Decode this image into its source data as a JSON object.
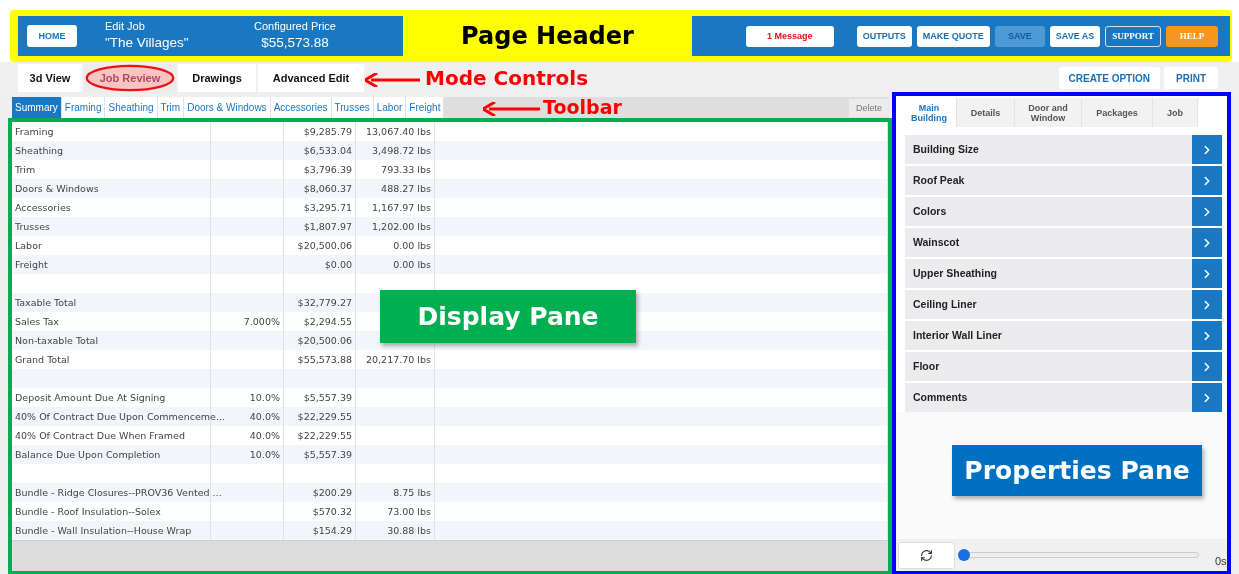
{
  "header": {
    "home_button": "HOME",
    "job_caption": "Edit Job",
    "job_name": "\"The Villages\"",
    "price_caption": "Configured Price",
    "price": "$55,573.88",
    "buttons": [
      {
        "label": "1 Message",
        "kind": "message"
      },
      {
        "label": "OUTPUTS",
        "kind": "normal"
      },
      {
        "label": "MAKE QUOTE",
        "kind": "normal"
      },
      {
        "label": "SAVE",
        "kind": "disabled"
      },
      {
        "label": "SAVE AS",
        "kind": "normal"
      },
      {
        "label": "SUPPORT",
        "kind": "outline"
      },
      {
        "label": "HELP",
        "kind": "orange"
      }
    ]
  },
  "mode_tabs": [
    {
      "label": "3d View",
      "selected": false,
      "circled": false
    },
    {
      "label": "Job Review",
      "selected": true,
      "circled": true
    },
    {
      "label": "Drawings",
      "selected": false,
      "circled": false
    },
    {
      "label": "Advanced Edit",
      "selected": false,
      "circled": false
    }
  ],
  "mode_actions": [
    "CREATE OPTION",
    "PRINT"
  ],
  "toolbar": {
    "tabs": [
      {
        "label": "Summary",
        "selected": true
      },
      {
        "label": "Framing",
        "selected": false
      },
      {
        "label": "Sheathing",
        "selected": false
      },
      {
        "label": "Trim",
        "selected": false
      },
      {
        "label": "Doors & Windows",
        "selected": false
      },
      {
        "label": "Accessories",
        "selected": false
      },
      {
        "label": "Trusses",
        "selected": false
      },
      {
        "label": "Labor",
        "selected": false
      },
      {
        "label": "Freight",
        "selected": false
      }
    ],
    "delete_button": "Delete"
  },
  "summary_table": {
    "rows": [
      {
        "kind": "line",
        "item": "Framing",
        "price": "$9,285.79",
        "weight": "13,067.40 lbs"
      },
      {
        "kind": "line",
        "item": "Sheathing",
        "price": "$6,533.04",
        "weight": "3,498.72 lbs"
      },
      {
        "kind": "line",
        "item": "Trim",
        "price": "$3,796.39",
        "weight": "793.33 lbs"
      },
      {
        "kind": "line",
        "item": "Doors & Windows",
        "price": "$8,060.37",
        "weight": "488.27 lbs"
      },
      {
        "kind": "line",
        "item": "Accessories",
        "price": "$3,295.71",
        "weight": "1,167.97 lbs"
      },
      {
        "kind": "line",
        "item": "Trusses",
        "price": "$1,807.97",
        "weight": "1,202.00 lbs"
      },
      {
        "kind": "line",
        "item": "Labor",
        "price": "$20,500.06",
        "weight": "0.00 lbs"
      },
      {
        "kind": "line",
        "item": "Freight",
        "price": "$0.00",
        "weight": "0.00 lbs"
      },
      {
        "kind": "spacer"
      },
      {
        "kind": "line",
        "item": "Taxable Total",
        "price": "$32,779.27"
      },
      {
        "kind": "line",
        "item": "Sales Tax",
        "percent": "7.000%",
        "price": "$2,294.55"
      },
      {
        "kind": "line",
        "item": "Non-taxable Total",
        "price": "$20,500.06"
      },
      {
        "kind": "line",
        "item": "Grand Total",
        "price": "$55,573.88",
        "weight": "20,217.70 lbs"
      },
      {
        "kind": "spacer"
      },
      {
        "kind": "line",
        "item": "Deposit Amount Due At Signing",
        "percent": "10.0%",
        "price": "$5,557.39"
      },
      {
        "kind": "line",
        "item": "40% Of Contract Due Upon Commenceme...",
        "percent": "40.0%",
        "price": "$22,229.55"
      },
      {
        "kind": "line",
        "item": "40% Of Contract Due When Framed",
        "percent": "40.0%",
        "price": "$22,229.55"
      },
      {
        "kind": "line",
        "item": "Balance Due Upon Completion",
        "percent": "10.0%",
        "price": "$5,557.39"
      },
      {
        "kind": "spacer"
      },
      {
        "kind": "line",
        "item": "Bundle - Ridge Closures--PROV36 Vented ...",
        "price": "$200.29",
        "weight": "8.75 lbs"
      },
      {
        "kind": "line",
        "item": "Bundle - Roof Insulation--Solex",
        "price": "$570.32",
        "weight": "73.00 lbs"
      },
      {
        "kind": "line",
        "item": "Bundle - Wall Insulation--House Wrap",
        "price": "$154.29",
        "weight": "30.88 lbs"
      }
    ]
  },
  "properties": {
    "tabs": [
      {
        "label": "Main Building",
        "selected": true
      },
      {
        "label": "Details",
        "selected": false
      },
      {
        "label": "Door and Window",
        "selected": false
      },
      {
        "label": "Packages",
        "selected": false
      },
      {
        "label": "Job",
        "selected": false
      }
    ],
    "sections": [
      "Building Size",
      "Roof Peak",
      "Colors",
      "Wainscot",
      "Upper Sheathing",
      "Ceiling Liner",
      "Interior Wall Liner",
      "Floor",
      "Comments"
    ],
    "playback": {
      "level": 0,
      "reading": "0s"
    }
  },
  "callouts": {
    "page_header": "Page Header",
    "mode_controls": "Mode Controls",
    "toolbar": "Toolbar",
    "display_pane": "Display Pane",
    "properties_pane": "Properties Pane"
  }
}
